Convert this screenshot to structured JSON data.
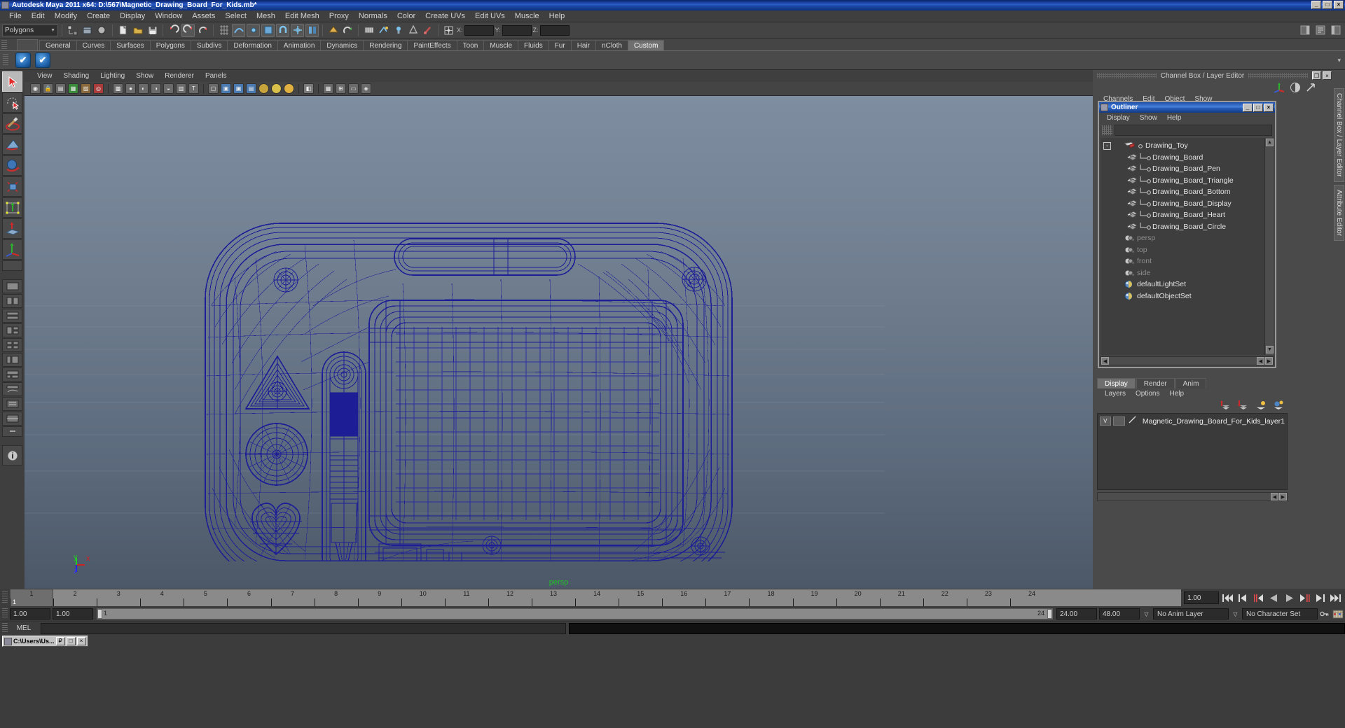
{
  "window": {
    "title": "Autodesk Maya 2011 x64: D:\\567\\Magnetic_Drawing_Board_For_Kids.mb*",
    "minimize": "_",
    "maximize": "□",
    "close": "×"
  },
  "menubar": {
    "items": [
      "File",
      "Edit",
      "Modify",
      "Create",
      "Display",
      "Window",
      "Assets",
      "Select",
      "Mesh",
      "Edit Mesh",
      "Proxy",
      "Normals",
      "Color",
      "Create UVs",
      "Edit UVs",
      "Muscle",
      "Help"
    ]
  },
  "statusbar": {
    "selection_mode": "Polygons",
    "axis": {
      "x_label": "X:",
      "y_label": "Y:",
      "z_label": "Z:",
      "x_value": "",
      "y_value": "",
      "z_value": ""
    }
  },
  "shelf": {
    "tabs": [
      "General",
      "Curves",
      "Surfaces",
      "Polygons",
      "Subdivs",
      "Deformation",
      "Animation",
      "Dynamics",
      "Rendering",
      "PaintEffects",
      "Toon",
      "Muscle",
      "Fluids",
      "Fur",
      "Hair",
      "nCloth",
      "Custom"
    ],
    "active_tab": "Custom",
    "icons": [
      "check-icon",
      "check-icon"
    ]
  },
  "viewport": {
    "menu": [
      "View",
      "Shading",
      "Lighting",
      "Show",
      "Renderer",
      "Panels"
    ],
    "camera_label": "persp",
    "axis_labels": {
      "x": "x",
      "y": "y",
      "z": "z"
    },
    "wire_color": "#1d1d96",
    "bg_top": "#7e8ea0",
    "bg_bottom": "#4c5867"
  },
  "right_panel": {
    "title": "Channel Box / Layer Editor",
    "restore": "❐",
    "close": "×",
    "channels_menu": [
      "Channels",
      "Edit",
      "Object",
      "Show"
    ],
    "vertical_tabs": [
      "Channel Box / Layer Editor",
      "Attribute Editor"
    ]
  },
  "outliner": {
    "title": "Outliner",
    "minimize": "_",
    "maximize": "□",
    "close": "×",
    "menu": [
      "Display",
      "Show",
      "Help"
    ],
    "search_value": "",
    "items": [
      {
        "label": "Drawing_Toy",
        "icon": "group-icon",
        "depth": 0,
        "dim": false,
        "expander": "-"
      },
      {
        "label": "Drawing_Board",
        "icon": "mesh-icon",
        "depth": 1,
        "dim": false
      },
      {
        "label": "Drawing_Board_Pen",
        "icon": "mesh-icon",
        "depth": 1,
        "dim": false
      },
      {
        "label": "Drawing_Board_Triangle",
        "icon": "mesh-icon",
        "depth": 1,
        "dim": false
      },
      {
        "label": "Drawing_Board_Bottom",
        "icon": "mesh-icon",
        "depth": 1,
        "dim": false
      },
      {
        "label": "Drawing_Board_Display",
        "icon": "mesh-icon",
        "depth": 1,
        "dim": false
      },
      {
        "label": "Drawing_Board_Heart",
        "icon": "mesh-icon",
        "depth": 1,
        "dim": false
      },
      {
        "label": "Drawing_Board_Circle",
        "icon": "mesh-icon",
        "depth": 1,
        "dim": false
      },
      {
        "label": "persp",
        "icon": "camera-icon",
        "depth": 0,
        "dim": true
      },
      {
        "label": "top",
        "icon": "camera-icon",
        "depth": 0,
        "dim": true
      },
      {
        "label": "front",
        "icon": "camera-icon",
        "depth": 0,
        "dim": true
      },
      {
        "label": "side",
        "icon": "camera-icon",
        "depth": 0,
        "dim": true
      },
      {
        "label": "defaultLightSet",
        "icon": "set-icon",
        "depth": 0,
        "dim": false
      },
      {
        "label": "defaultObjectSet",
        "icon": "set-icon",
        "depth": 0,
        "dim": false
      }
    ]
  },
  "layer_editor": {
    "tabs": [
      "Display",
      "Render",
      "Anim"
    ],
    "active_tab": "Display",
    "menu": [
      "Layers",
      "Options",
      "Help"
    ],
    "layers": [
      {
        "visibility": "V",
        "type": "",
        "name": "Magnetic_Drawing_Board_For_Kids_layer1"
      }
    ]
  },
  "time_slider": {
    "ticks": [
      1,
      2,
      3,
      4,
      5,
      6,
      7,
      8,
      9,
      10,
      11,
      12,
      13,
      14,
      15,
      16,
      17,
      18,
      19,
      20,
      21,
      22,
      23,
      24
    ],
    "current_frame": "1",
    "current_frame_field": "1.00",
    "playback_buttons": [
      "go-to-start-icon",
      "step-back-frame-icon",
      "step-back-key-icon",
      "play-backwards-icon",
      "play-forwards-icon",
      "step-forward-key-icon",
      "step-forward-frame-icon",
      "go-to-end-icon"
    ]
  },
  "range_slider": {
    "anim_start": "1.00",
    "range_start": "1.00",
    "bar_start_label": "1",
    "bar_end_label": "24",
    "range_end": "24.00",
    "anim_end": "48.00",
    "anim_layer": "No Anim Layer",
    "character_set": "No Character Set"
  },
  "command_line": {
    "language_label": "MEL",
    "input_value": "",
    "output_value": ""
  },
  "taskbar": {
    "items": [
      {
        "label": "C:\\Users\\Us...",
        "restore": "₽",
        "maximize": "□",
        "close": "×"
      }
    ]
  }
}
